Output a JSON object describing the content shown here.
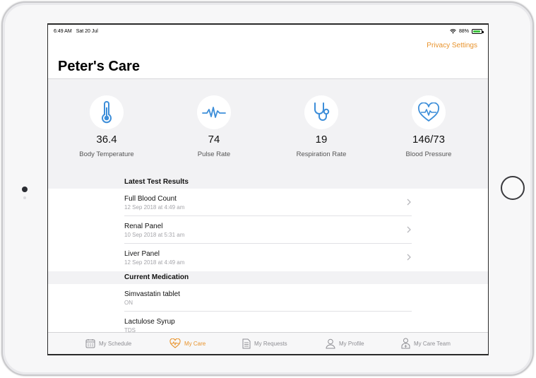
{
  "status_bar": {
    "time": "6:49 AM",
    "date": "Sat 20 Jul",
    "battery": "88%",
    "battery_level": 0.88
  },
  "header": {
    "privacy_link": "Privacy Settings",
    "title": "Peter's Care"
  },
  "vitals": [
    {
      "icon": "thermometer-icon",
      "value": "36.4",
      "label": "Body Temperature"
    },
    {
      "icon": "pulse-icon",
      "value": "74",
      "label": "Pulse Rate"
    },
    {
      "icon": "stethoscope-icon",
      "value": "19",
      "label": "Respiration Rate"
    },
    {
      "icon": "heart-pulse-icon",
      "value": "146/73",
      "label": "Blood Pressure"
    }
  ],
  "test_results": {
    "header": "Latest Test Results",
    "items": [
      {
        "title": "Full Blood Count",
        "date": "12 Sep 2018 at 4:49 am"
      },
      {
        "title": "Renal Panel",
        "date": "10 Sep 2018 at 5:31 am"
      },
      {
        "title": "Liver Panel",
        "date": "12 Sep 2018 at 4:49 am"
      }
    ]
  },
  "medication": {
    "header": "Current Medication",
    "items": [
      {
        "title": "Simvastatin tablet",
        "detail": "ON"
      },
      {
        "title": "Lactulose Syrup",
        "detail": "TDS"
      }
    ]
  },
  "tabs": [
    {
      "label": "My Schedule",
      "icon": "calendar-icon",
      "active": false
    },
    {
      "label": "My Care",
      "icon": "heart-icon",
      "active": true
    },
    {
      "label": "My Requests",
      "icon": "document-icon",
      "active": false
    },
    {
      "label": "My Profile",
      "icon": "person-icon",
      "active": false
    },
    {
      "label": "My Care Team",
      "icon": "care-team-icon",
      "active": false
    }
  ],
  "colors": {
    "accent": "#e8932c",
    "icon_blue": "#3d8ed9",
    "section_bg": "#f2f2f4"
  }
}
